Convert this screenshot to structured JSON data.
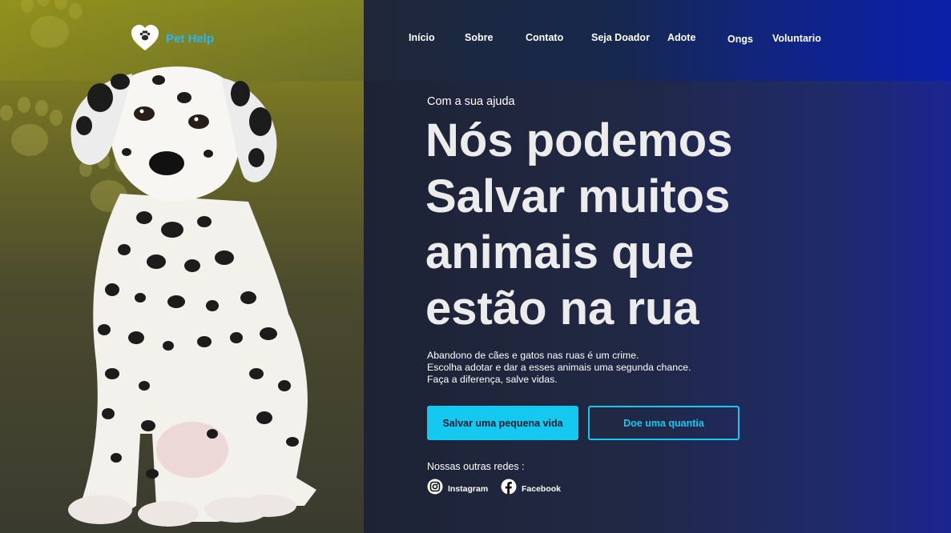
{
  "brand": {
    "name": "Pet Help",
    "logo_icon": "heart-paw-icon",
    "accent_color": "#29b6f6"
  },
  "nav": {
    "items": [
      "Início",
      "Sobre",
      "Contato",
      "Seja Doador",
      "Adote",
      "Ongs",
      "Voluntario"
    ]
  },
  "hero": {
    "kicker": "Com a sua ajuda",
    "title_lines": [
      "Nós podemos",
      "Salvar muitos",
      "animais que",
      "estão na rua"
    ],
    "description_lines": [
      "Abandono de cães e gatos nas ruas é um crime.",
      "Escolha adotar e dar a esses animais uma segunda chance.",
      "Faça a diferença, salve vidas."
    ],
    "image": "dalmatian-puppy"
  },
  "actions": {
    "primary_label": "Salvar uma pequena vida",
    "secondary_label": "Doe uma quantia",
    "button_color": "#14c8f0"
  },
  "social": {
    "label": "Nossas outras redes :",
    "links": [
      {
        "label": "Instagram",
        "icon": "instagram-icon"
      },
      {
        "label": "Facebook",
        "icon": "facebook-icon"
      }
    ]
  }
}
